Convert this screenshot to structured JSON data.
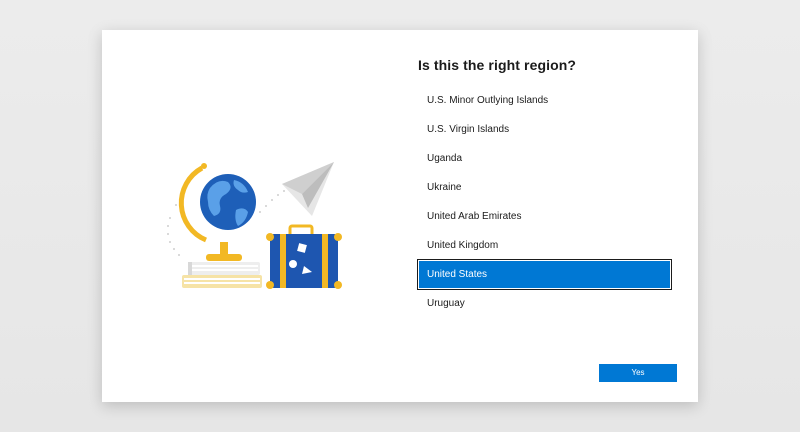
{
  "dialog": {
    "title": "Is this the right region?",
    "regions": [
      "U.S. Minor Outlying Islands",
      "U.S. Virgin Islands",
      "Uganda",
      "Ukraine",
      "United Arab Emirates",
      "United Kingdom",
      "United States",
      "Uruguay"
    ],
    "selected_region": "United States",
    "yes_label": "Yes"
  },
  "colors": {
    "accent": "#0078d4",
    "globe_blue": "#1e5fb8",
    "globe_light": "#5aa0e8",
    "stand_gold": "#f2b824",
    "suitcase": "#1e56b0"
  },
  "illustration": {
    "icons": [
      "globe-icon",
      "paper-plane-icon",
      "books-icon",
      "suitcase-icon"
    ]
  }
}
